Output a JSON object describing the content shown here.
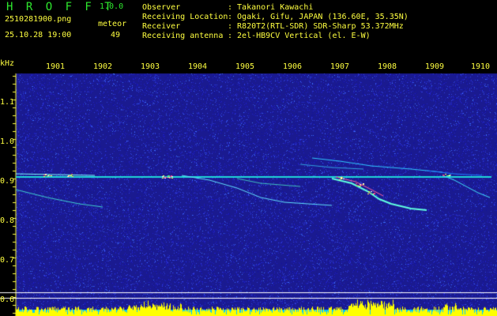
{
  "app": {
    "title": "H R O F F T",
    "version": "1.0.0"
  },
  "waterfall": {
    "file": "2510281900.png",
    "datetime": "25.10.28 19:00",
    "meteor_label": "meteor",
    "meteor_count": "49"
  },
  "info": [
    {
      "key": "Observer",
      "value": ": Takanori Kawachi"
    },
    {
      "key": "Receiving Location",
      "value": ": Ogaki, Gifu, JAPAN (136.60E, 35.35N)"
    },
    {
      "key": "Receiver",
      "value": ": R820T2(RTL-SDR) SDR-Sharp 53.372MHz"
    },
    {
      "key": "Receiving antenna",
      "value": ": 2el-HB9CV Vertical (el. E-W)"
    }
  ],
  "time_axis": [
    "1901",
    "1902",
    "1903",
    "1904",
    "1905",
    "1906",
    "1907",
    "1908",
    "1909",
    "1910"
  ],
  "freq_axis": {
    "unit": "kHz",
    "labels": [
      "1.1",
      "1.0",
      "0.9",
      "0.8",
      "0.7",
      "0.6"
    ]
  },
  "colors": {
    "text_green": "#2ee82e",
    "text_yellow": "#ffff40",
    "background": "#1a1a90",
    "carrier": "#20d8d8",
    "level_fill": "#ffff00",
    "level_base": "#00c8ff"
  }
}
